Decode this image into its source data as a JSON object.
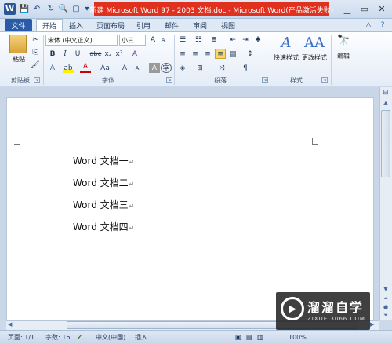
{
  "window": {
    "title": "新建 Microsoft Word 97 - 2003 文档.doc  -  Microsoft Word(产品激活失败)",
    "app_icon": "W"
  },
  "qat": {
    "save": "save-icon",
    "undo": "undo-icon",
    "redo": "redo-icon",
    "new": "new-doc-icon"
  },
  "tabs": [
    "文件",
    "开始",
    "插入",
    "页面布局",
    "引用",
    "邮件",
    "审阅",
    "视图"
  ],
  "ribbon": {
    "clipboard": {
      "paste_label": "粘贴",
      "group_label": "剪贴板"
    },
    "font": {
      "font_name": "宋体 (中文正文)",
      "font_size": "小三",
      "group_label": "字体",
      "bold": "B",
      "italic": "I",
      "underline": "U",
      "strike": "abe",
      "sub": "x₂",
      "sup": "x²",
      "grow": "A",
      "shrink": "A",
      "case": "Aa",
      "clear": "A",
      "phonetic": "A",
      "charborder": "A"
    },
    "paragraph": {
      "group_label": "段落"
    },
    "styles": {
      "quick_label": "快速样式",
      "change_label": "更改样式",
      "group_label": "样式"
    },
    "editing": {
      "label": "编辑"
    }
  },
  "document": {
    "lines": [
      "Word 文档一",
      "Word 文档二",
      "Word 文档三",
      "Word 文档四"
    ],
    "para_mark": "↵"
  },
  "statusbar": {
    "page": "页面: 1/1",
    "words": "字数: 16",
    "lang": "中文(中国)",
    "mode": "插入",
    "zoom": "100%"
  },
  "watermark": {
    "title": "溜溜自学",
    "sub": "ZIXUE.3066.COM"
  }
}
